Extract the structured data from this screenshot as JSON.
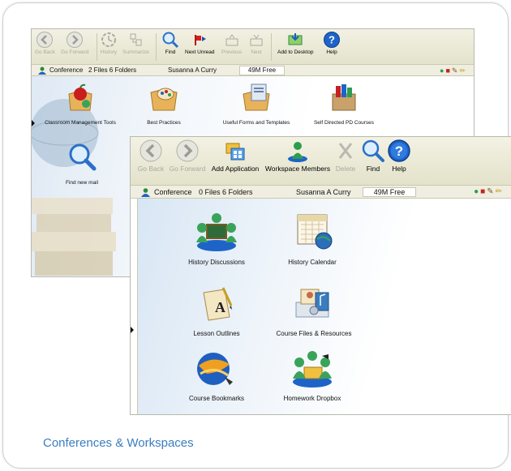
{
  "caption": "Conferences & Workspaces",
  "back_window": {
    "toolbar": {
      "go_back": "Go Back",
      "go_forward": "Go Forward",
      "history": "History",
      "summarize": "Summarize",
      "find": "Find",
      "next_unread": "Next Unread",
      "previous": "Previous",
      "next": "Next",
      "add_to_desktop": "Add to Desktop",
      "help": "Help"
    },
    "status": {
      "name": "Conference",
      "counts": "2 Files  6 Folders",
      "user": "Susanna A Curry",
      "free": "49M Free"
    },
    "items": {
      "classroom": "Classroom Management Tools",
      "best_practices": "Best Practices",
      "useful_forms": "Useful Forms and Templates",
      "self_directed": "Self Directed PD Courses",
      "find_new_mail": "Find new mail"
    }
  },
  "front_window": {
    "toolbar": {
      "go_back": "Go Back",
      "go_forward": "Go Forward",
      "add_application": "Add Application",
      "workspace_members": "Workspace Members",
      "delete": "Delete",
      "find": "Find",
      "help": "Help"
    },
    "status": {
      "name": "Conference",
      "counts": "0 Files  6 Folders",
      "user": "Susanna A Curry",
      "free": "49M Free"
    },
    "items": {
      "history_discussions": "History Discussions",
      "history_calendar": "History Calendar",
      "lesson_outlines": "Lesson Outlines",
      "course_files": "Course Files & Resources",
      "course_bookmarks": "Course Bookmarks",
      "homework_dropbox": "Homework Dropbox"
    }
  },
  "colors": {
    "caption": "#3a7dbf",
    "toolbar": "#e9e8d2",
    "accent_green": "#2e9d4d",
    "help_blue": "#1e64c8"
  }
}
